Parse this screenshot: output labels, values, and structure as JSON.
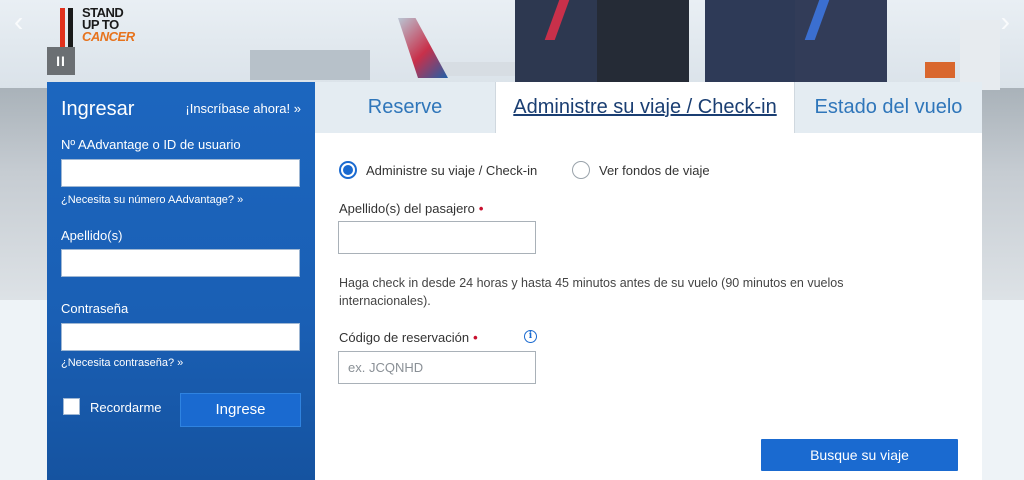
{
  "hero": {
    "logo_lines": [
      "STAND",
      "UP TO",
      "CANCER"
    ],
    "pause_label": "II",
    "nav_left": "‹",
    "nav_right": "›"
  },
  "login": {
    "title": "Ingresar",
    "signup_link": "¡Inscríbase ahora! »",
    "aadvantage_label": "Nº AAdvantage o ID de usuario",
    "aadvantage_help": "¿Necesita su número AAdvantage? »",
    "lastname_label": "Apellido(s)",
    "password_label": "Contraseña",
    "password_help": "¿Necesita contraseña? »",
    "remember_label": "Recordarme",
    "submit_label": "Ingrese"
  },
  "tabs": {
    "reserve": "Reserve",
    "manage": "Administre su viaje / Check-in",
    "status": "Estado del vuelo"
  },
  "form": {
    "radio_manage": "Administre su viaje / Check-in",
    "radio_funds": "Ver fondos de viaje",
    "selected_option": "Administre su viaje / Check-in",
    "passenger_lastname_label": "Apellido(s) del pasajero",
    "required_mark": "•",
    "checkin_note": "Haga check in desde 24 horas y hasta 45 minutos antes de su vuelo (90 minutos en vuelos internacionales).",
    "record_locator_label": "Código de reservación",
    "record_locator_placeholder": "ex. JCQNHD",
    "info_glyph": "i",
    "search_button": "Busque su viaje"
  },
  "colors": {
    "login_panel": "#1a5fb4",
    "primary_button": "#1a6ad0",
    "tab_text": "#2f76ba",
    "required": "#c8102e"
  },
  "icons": {
    "pause": "pause-icon",
    "info": "info-icon",
    "carousel_prev": "chevron-left-icon",
    "carousel_next": "chevron-right-icon"
  }
}
